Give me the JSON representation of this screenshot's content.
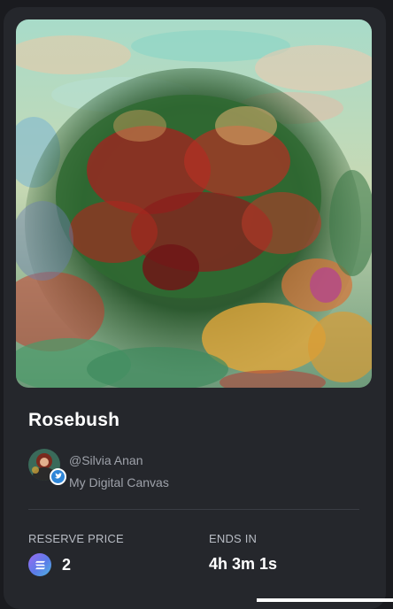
{
  "nft": {
    "title": "Rosebush",
    "creator_handle": "@Silvia Anan",
    "collection": "My Digital Canvas"
  },
  "auction": {
    "reserve_label": "RESERVE PRICE",
    "reserve_value": "2",
    "ends_label": "ENDS IN",
    "ends_value": "4h 3m 1s"
  },
  "icons": {
    "currency": "solana-icon",
    "verified": "twitter-bird-icon"
  },
  "colors": {
    "card_bg": "#25272c",
    "page_bg": "#1a1b1f",
    "text_primary": "#ffffff",
    "text_muted": "#9ea2aa"
  }
}
